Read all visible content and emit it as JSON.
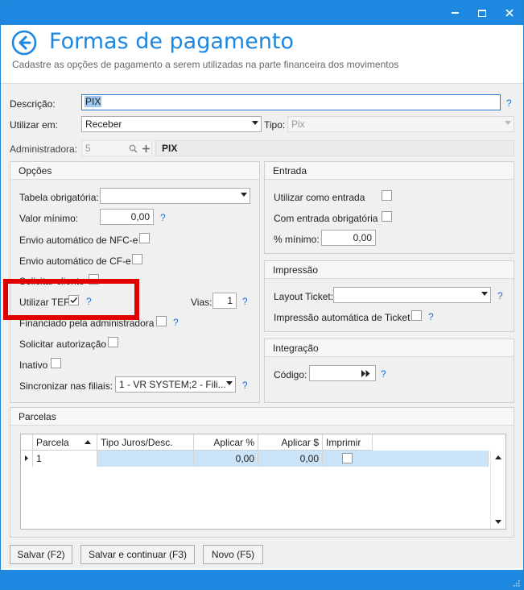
{
  "window": {
    "minimize_glyph": "–",
    "maximize_glyph": "□",
    "close_glyph": "✕"
  },
  "header": {
    "title": "Formas de pagamento",
    "subtitle": "Cadastre as opções de pagamento a serem utilizadas na parte financeira dos movimentos"
  },
  "form": {
    "descricao_label": "Descrição:",
    "descricao_value": "PIX",
    "utilizar_em_label": "Utilizar em:",
    "utilizar_em_value": "Receber",
    "tipo_label": "Tipo:",
    "tipo_value": "Pix",
    "administradora_label": "Administradora:",
    "administradora_code": "5",
    "administradora_name": "PIX",
    "help": "?"
  },
  "opcoes": {
    "title": "Opções",
    "tabela_label": "Tabela obrigatória:",
    "tabela_value": "",
    "valor_minimo_label": "Valor mínimo:",
    "valor_minimo_value": "0,00",
    "nfce_label": "Envio automático de NFC-e",
    "cfe_label": "Envio automático de CF-e",
    "solicitar_cliente_label": "Solicitar cliente",
    "utilizar_tef_label": "Utilizar TEF",
    "utilizar_tef_checked": true,
    "vias_label": "Vias:",
    "vias_value": "1",
    "financiado_label": "Financiado pela administradora",
    "solicitar_autorizacao_label": "Solicitar autorização",
    "inativo_label": "Inativo",
    "sincronizar_label": "Sincronizar nas filiais:",
    "sincronizar_value": "1 - VR SYSTEM;2 - Fili..."
  },
  "entrada": {
    "title": "Entrada",
    "utilizar_como_entrada_label": "Utilizar como entrada",
    "com_entrada_label": "Com entrada obrigatória",
    "minimo_label": "% mínimo:",
    "minimo_value": "0,00"
  },
  "impressao": {
    "title": "Impressão",
    "layout_label": "Layout Ticket:",
    "layout_value": "",
    "auto_label": "Impressão automática de Ticket"
  },
  "integracao": {
    "title": "Integração",
    "codigo_label": "Código:",
    "codigo_value": ""
  },
  "parcelas": {
    "title": "Parcelas",
    "columns": [
      "Parcela",
      "Tipo Juros/Desc.",
      "Aplicar %",
      "Aplicar $",
      "Imprimir"
    ],
    "rows": [
      {
        "parcela": "1",
        "tipo": "",
        "aplicar_pct": "0,00",
        "aplicar_val": "0,00",
        "imprimir": false
      }
    ]
  },
  "buttons": {
    "salvar": "Salvar (F2)",
    "salvar_continuar": "Salvar e continuar (F3)",
    "novo": "Novo (F5)"
  },
  "colors": {
    "accent": "#1e88e0",
    "highlight": "#e10000",
    "selected_row": "#cce4f7"
  }
}
